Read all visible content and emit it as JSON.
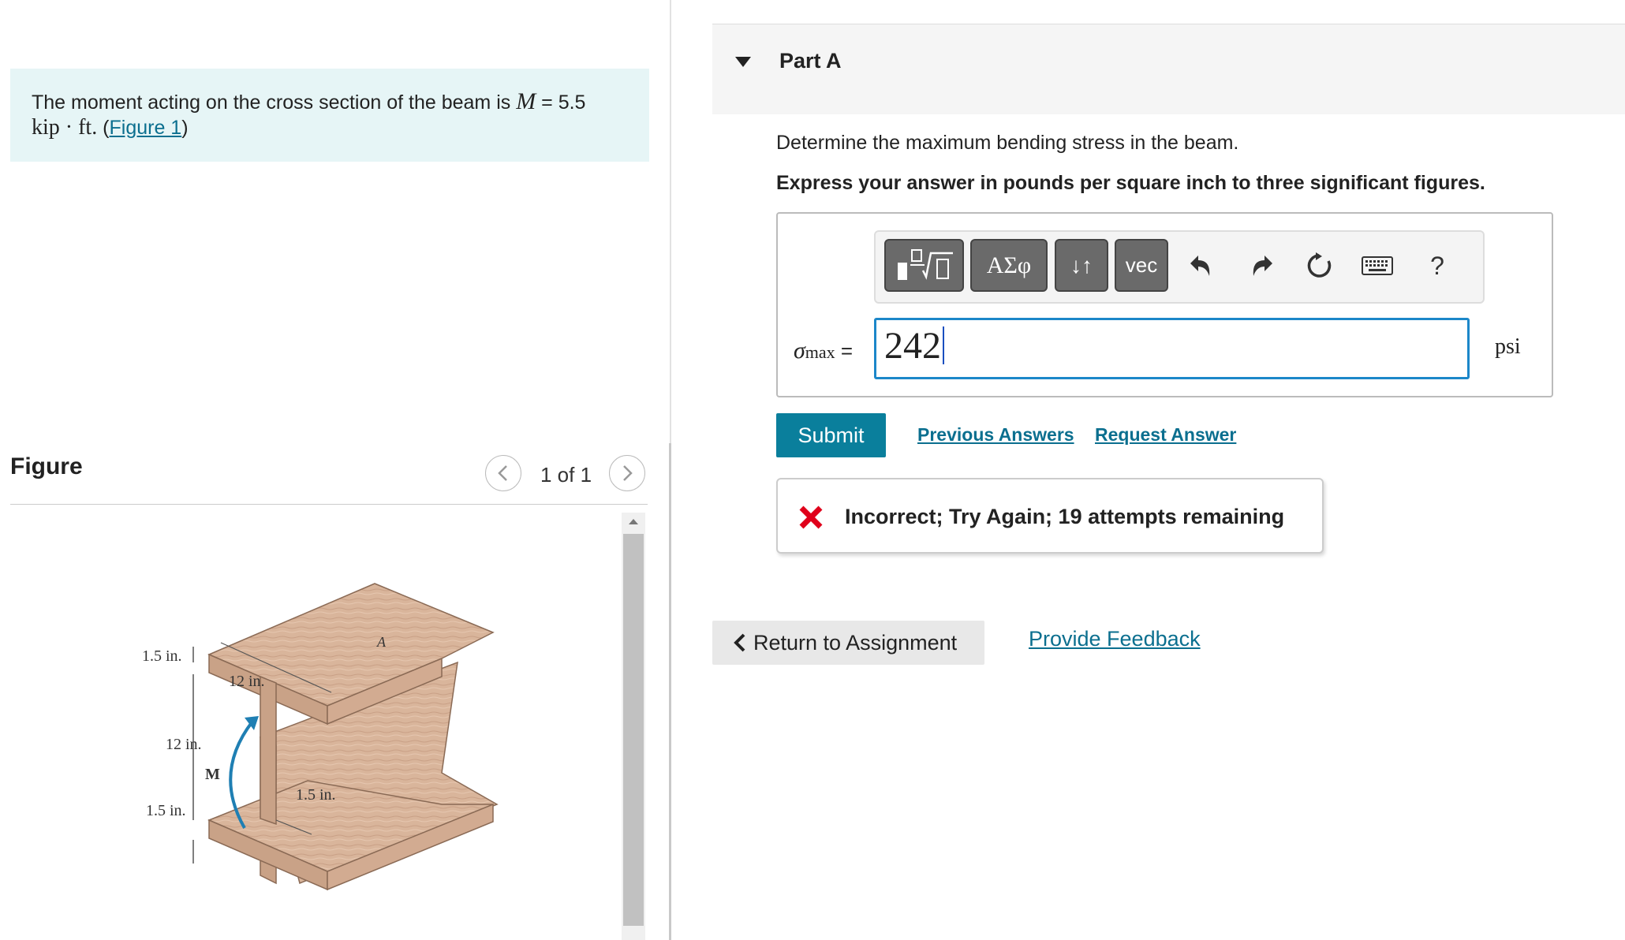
{
  "problem": {
    "text_prefix": "The moment acting on the cross section of the beam is ",
    "symbol": "M",
    "equals": " = 5.5",
    "units": "kip · ft.",
    "link_open": " (",
    "link_text": "Figure 1",
    "link_close": ")"
  },
  "figure": {
    "title": "Figure",
    "page_count": "1 of 1",
    "labels": {
      "top_flange": "1.5 in.",
      "width": "12 in.",
      "web_height": "12 in.",
      "moment": "M",
      "web_thickness": "1.5 in.",
      "bottom_flange": "1.5 in.",
      "point": "A"
    }
  },
  "part": {
    "title": "Part A",
    "question": "Determine the maximum bending stress in the beam.",
    "instruction": "Express your answer in pounds per square inch to three significant figures."
  },
  "toolbar": {
    "greek_label": "ΑΣφ",
    "arrows_label": "↓↑",
    "vec_label": "vec",
    "help_label": "?"
  },
  "answer": {
    "symbol": "σ",
    "subscript": "max",
    "equals": "=",
    "value": "242",
    "unit": "psi"
  },
  "actions": {
    "submit": "Submit",
    "previous": "Previous Answers",
    "request": "Request Answer"
  },
  "feedback": {
    "message": "Incorrect; Try Again; 19 attempts remaining",
    "status_color": "#e0001b"
  },
  "footer": {
    "return": "Return to Assignment",
    "provide": "Provide Feedback"
  }
}
